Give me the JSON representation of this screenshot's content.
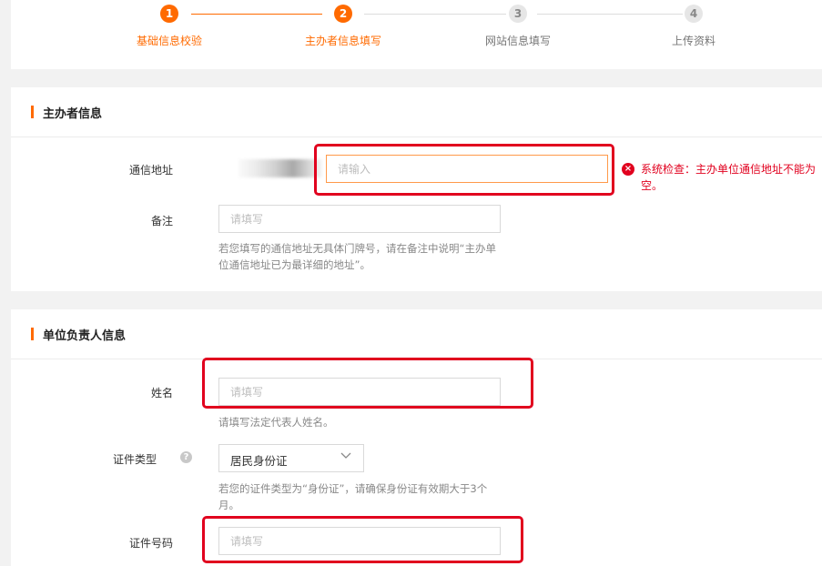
{
  "steps": [
    {
      "num": "1",
      "label": "基础信息校验",
      "state": "active"
    },
    {
      "num": "2",
      "label": "主办者信息填写",
      "state": "active"
    },
    {
      "num": "3",
      "label": "网站信息填写",
      "state": "todo"
    },
    {
      "num": "4",
      "label": "上传资料",
      "state": "todo"
    }
  ],
  "sponsor": {
    "title": "主办者信息",
    "address": {
      "label": "通信地址",
      "placeholder": "请输入",
      "error": "系统检查：主办单位通信地址不能为空。",
      "error_icon": "x-circle-icon"
    },
    "remark": {
      "label": "备注",
      "placeholder": "请填写",
      "hint": "若您填写的通信地址无具体门牌号，请在备注中说明“主办单位通信地址已为最详细的地址”。"
    }
  },
  "person": {
    "title": "单位负责人信息",
    "name": {
      "label": "姓名",
      "placeholder": "请填写",
      "hint": "请填写法定代表人姓名。"
    },
    "id_type": {
      "label": "证件类型",
      "value": "居民身份证",
      "help_icon": "question-circle-icon",
      "hint": "若您的证件类型为“身份证”，请确保身份证有效期大于3个月。"
    },
    "id_number": {
      "label": "证件号码",
      "placeholder": "请填写"
    }
  },
  "colors": {
    "accent": "#ff6a00",
    "error": "#e1001e",
    "annotation_box": "#e1001e"
  }
}
